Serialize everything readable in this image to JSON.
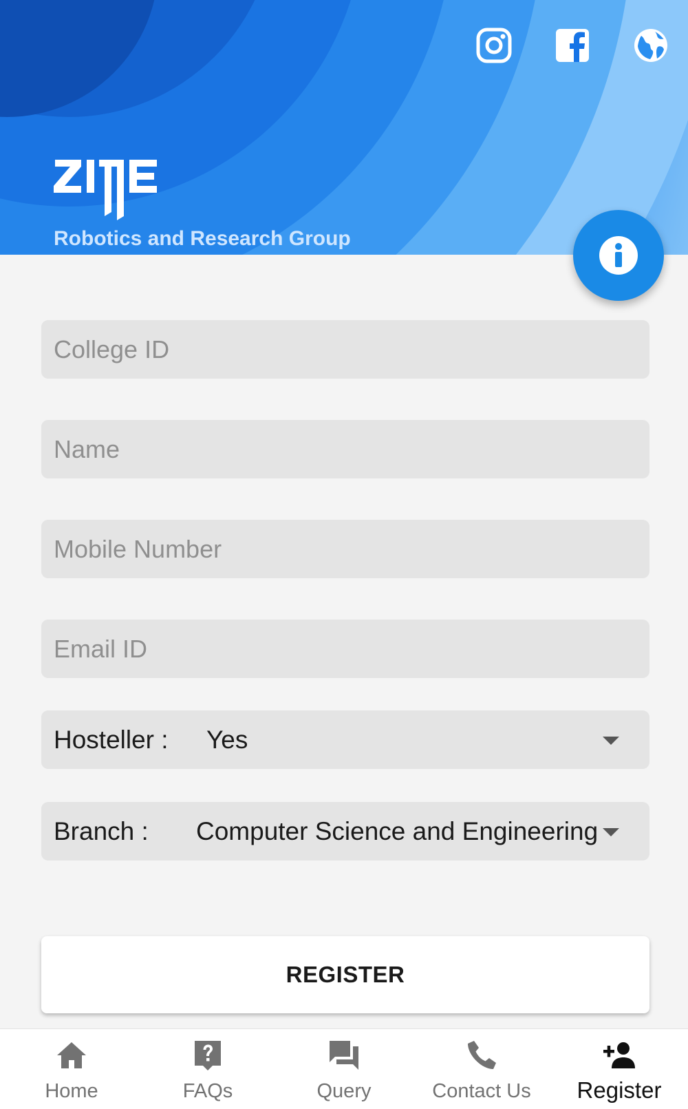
{
  "header": {
    "social_icons": [
      "instagram-icon",
      "facebook-icon",
      "globe-icon"
    ],
    "logo_text": "ZINE",
    "tagline": "Robotics and Research Group",
    "info_icon": "info-icon"
  },
  "form": {
    "college_id": {
      "placeholder": "College ID",
      "value": ""
    },
    "name": {
      "placeholder": "Name",
      "value": ""
    },
    "mobile": {
      "placeholder": "Mobile Number",
      "value": ""
    },
    "email": {
      "placeholder": "Email ID",
      "value": ""
    },
    "hosteller": {
      "label": "Hosteller :",
      "value": "Yes"
    },
    "branch": {
      "label": "Branch :",
      "value": "Computer Science and Engineering"
    },
    "register_label": "REGISTER"
  },
  "bottom_nav": {
    "items": [
      {
        "label": "Home",
        "icon": "home-icon",
        "active": false
      },
      {
        "label": "FAQs",
        "icon": "faq-icon",
        "active": false
      },
      {
        "label": "Query",
        "icon": "chat-icon",
        "active": false
      },
      {
        "label": "Contact Us",
        "icon": "phone-icon",
        "active": false
      },
      {
        "label": "Register",
        "icon": "add-person-icon",
        "active": true
      }
    ]
  },
  "colors": {
    "header_blue": "#1774e8",
    "fab_blue": "#1a8ae6",
    "field_bg": "#e4e4e4",
    "page_bg": "#f4f4f4"
  }
}
